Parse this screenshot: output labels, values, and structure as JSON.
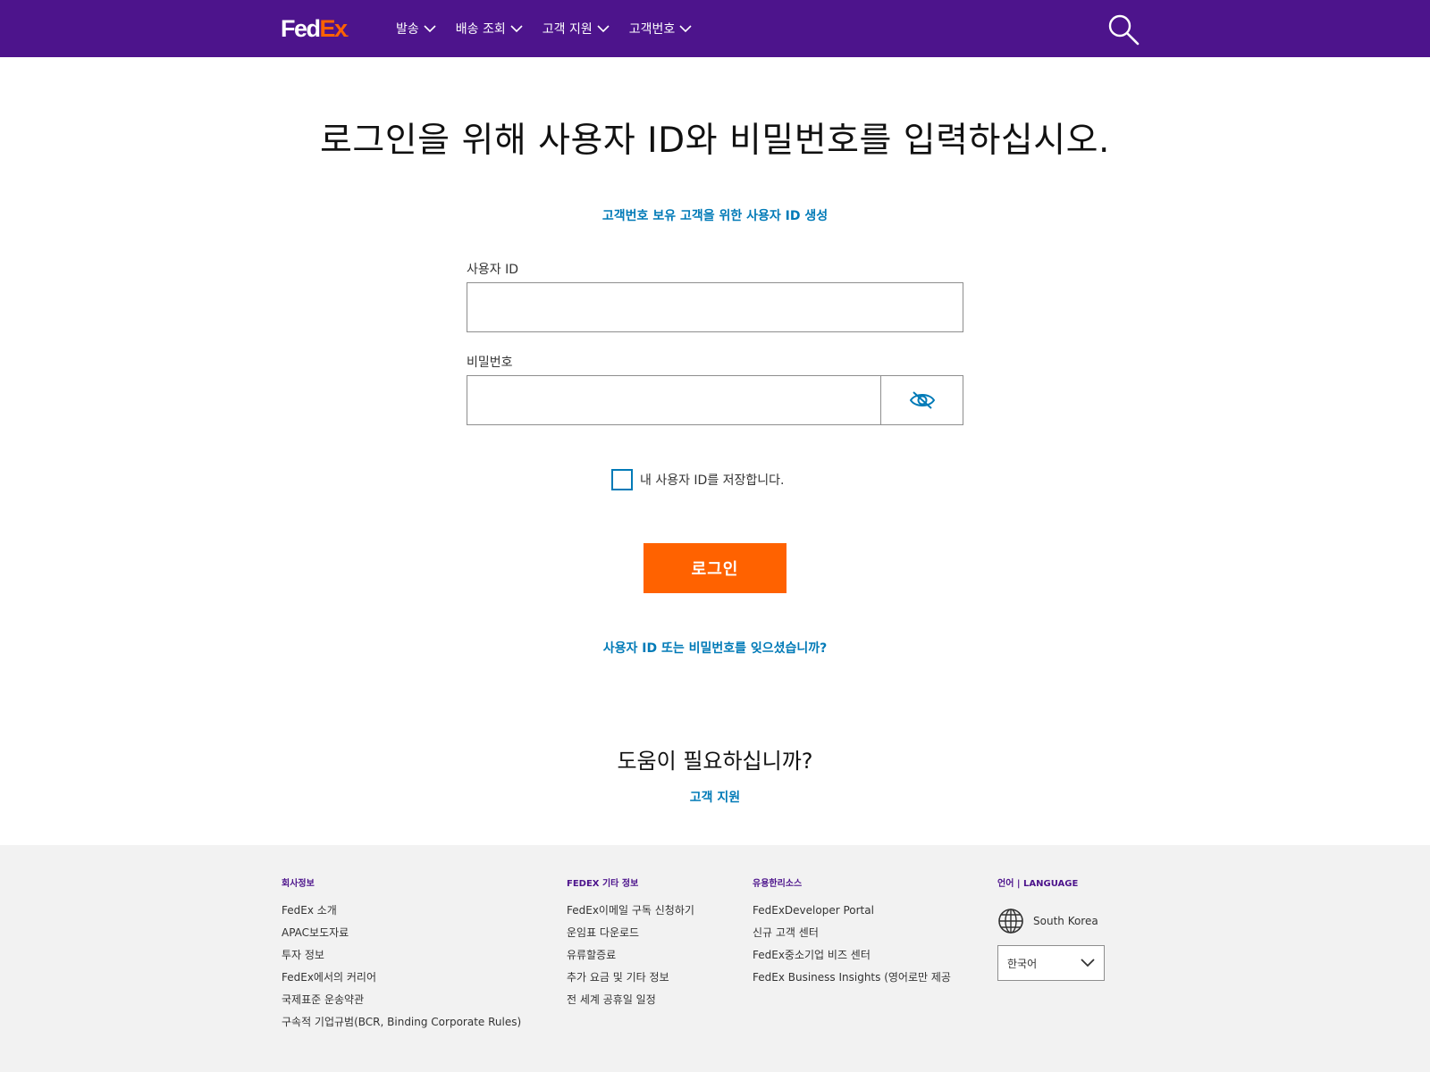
{
  "header": {
    "logo_fed": "Fed",
    "logo_ex": "Ex",
    "logo_dot": ".",
    "nav": [
      {
        "label": "발송"
      },
      {
        "label": "배송 조회"
      },
      {
        "label": "고객 지원"
      },
      {
        "label": "고객번호"
      }
    ],
    "search_icon": "search-icon"
  },
  "main": {
    "title": "로그인을 위해 사용자 ID와 비밀번호를 입력하십시오.",
    "create_link": "고객번호 보유 고객을 위한 사용자 ID 생성",
    "user_id_label": "사용자 ID",
    "user_id_value": "",
    "password_label": "비밀번호",
    "password_value": "",
    "password_toggle_icon": "eye-slash-icon",
    "remember_label": "내 사용자 ID를 저장합니다.",
    "remember_checked": false,
    "login_button": "로그인",
    "forgot_link": "사용자 ID 또는 비밀번호를 잊으셨습니까?",
    "help_title": "도움이 필요하십니까?",
    "help_link": "고객 지원"
  },
  "footer": {
    "company": {
      "heading": "회사정보",
      "links": [
        "FedEx 소개",
        "APAC보도자료",
        "투자 정보",
        "FedEx에서의 커리어",
        "국제표준 운송약관",
        "구속적 기업규범(BCR, Binding Corporate Rules)"
      ]
    },
    "more": {
      "heading": "FEDEX 기타 정보",
      "links": [
        "FedEx이메일 구독 신청하기",
        "운임표 다운로드",
        "유류할증료",
        "추가 요금 및 기타 정보",
        "전 세계 공휴일 일정"
      ]
    },
    "resources": {
      "heading": "유용한리소스",
      "links": [
        "FedExDeveloper Portal",
        "신규 고객 센터",
        "FedEx중소기업 비즈 센터",
        "FedEx Business Insights (영어로만 제공"
      ]
    },
    "language": {
      "heading": "언어 | LANGUAGE",
      "country": "South Korea",
      "selected": "한국어"
    }
  },
  "colors": {
    "header_bg": "#4d148c",
    "accent_orange": "#ff6200",
    "link_blue": "#007ab7",
    "footer_bg": "#f2f2f2"
  }
}
